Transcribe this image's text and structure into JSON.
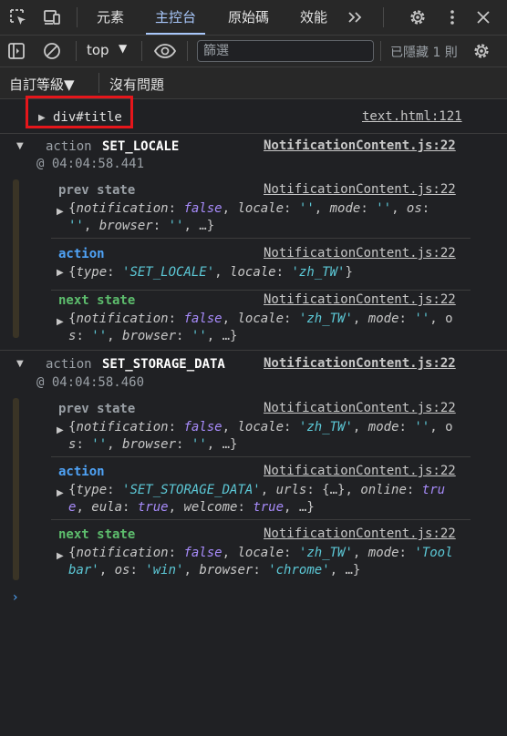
{
  "tabs": [
    {
      "label": "元素"
    },
    {
      "label": "主控台"
    },
    {
      "label": "原始碼"
    },
    {
      "label": "效能"
    }
  ],
  "toolbar": {
    "context": "top",
    "filter_placeholder": "篩選",
    "hidden_count": "已隱藏 1 則"
  },
  "levels": {
    "default_levels": "自訂等級▼",
    "issues": "沒有問題"
  },
  "console": {
    "element_log": {
      "text": "div#title",
      "source": "text.html:121"
    },
    "groups": [
      {
        "prefix": "action",
        "name": "SET_LOCALE",
        "time": "@ 04:04:58.441",
        "source": "NotificationContent.js:22",
        "entries": [
          {
            "label": "prev state",
            "source": "NotificationContent.js:22",
            "line1": [
              [
                "{",
                "p"
              ],
              [
                "notification",
                "i"
              ],
              [
                ": ",
                "p"
              ],
              [
                "false",
                "k"
              ],
              [
                ", ",
                "p"
              ],
              [
                "locale",
                "i"
              ],
              [
                ": ",
                "p"
              ],
              [
                "''",
                "s"
              ],
              [
                ", ",
                "p"
              ],
              [
                "mode",
                "i"
              ],
              [
                ": ",
                "p"
              ],
              [
                "''",
                "s"
              ],
              [
                ", ",
                "p"
              ],
              [
                "os",
                "i"
              ],
              [
                ":",
                "p"
              ]
            ],
            "line2": [
              [
                "''",
                "s"
              ],
              [
                ", ",
                "p"
              ],
              [
                "browser",
                "i"
              ],
              [
                ": ",
                "p"
              ],
              [
                "''",
                "s"
              ],
              [
                ", …}",
                "p"
              ]
            ]
          },
          {
            "label": "action",
            "source": "NotificationContent.js:22",
            "line1": [
              [
                "{",
                "p"
              ],
              [
                "type",
                "i"
              ],
              [
                ": ",
                "p"
              ],
              [
                "'SET_LOCALE'",
                "s"
              ],
              [
                ", ",
                "p"
              ],
              [
                "locale",
                "i"
              ],
              [
                ": ",
                "p"
              ],
              [
                "'zh_TW'",
                "s"
              ],
              [
                "}",
                "p"
              ]
            ],
            "line2": []
          },
          {
            "label": "next state",
            "source": "NotificationContent.js:22",
            "line1": [
              [
                "{",
                "p"
              ],
              [
                "notification",
                "i"
              ],
              [
                ": ",
                "p"
              ],
              [
                "false",
                "k"
              ],
              [
                ", ",
                "p"
              ],
              [
                "locale",
                "i"
              ],
              [
                ": ",
                "p"
              ],
              [
                "'zh_TW'",
                "s"
              ],
              [
                ", ",
                "p"
              ],
              [
                "mode",
                "i"
              ],
              [
                ": ",
                "p"
              ],
              [
                "''",
                "s"
              ],
              [
                ", o",
                "p"
              ]
            ],
            "line2": [
              [
                "s",
                "i"
              ],
              [
                ": ",
                "p"
              ],
              [
                "''",
                "s"
              ],
              [
                ", ",
                "p"
              ],
              [
                "browser",
                "i"
              ],
              [
                ": ",
                "p"
              ],
              [
                "''",
                "s"
              ],
              [
                ", …}",
                "p"
              ]
            ]
          }
        ]
      },
      {
        "prefix": "action",
        "name": "SET_STORAGE_DATA",
        "time": "@ 04:04:58.460",
        "source": "NotificationContent.js:22",
        "entries": [
          {
            "label": "prev state",
            "source": "NotificationContent.js:22",
            "line1": [
              [
                "{",
                "p"
              ],
              [
                "notification",
                "i"
              ],
              [
                ": ",
                "p"
              ],
              [
                "false",
                "k"
              ],
              [
                ", ",
                "p"
              ],
              [
                "locale",
                "i"
              ],
              [
                ": ",
                "p"
              ],
              [
                "'zh_TW'",
                "s"
              ],
              [
                ", ",
                "p"
              ],
              [
                "mode",
                "i"
              ],
              [
                ": ",
                "p"
              ],
              [
                "''",
                "s"
              ],
              [
                ", o",
                "p"
              ]
            ],
            "line2": [
              [
                "s",
                "i"
              ],
              [
                ": ",
                "p"
              ],
              [
                "''",
                "s"
              ],
              [
                ", ",
                "p"
              ],
              [
                "browser",
                "i"
              ],
              [
                ": ",
                "p"
              ],
              [
                "''",
                "s"
              ],
              [
                ", …}",
                "p"
              ]
            ]
          },
          {
            "label": "action",
            "source": "NotificationContent.js:22",
            "line1": [
              [
                "{",
                "p"
              ],
              [
                "type",
                "i"
              ],
              [
                ": ",
                "p"
              ],
              [
                "'SET_STORAGE_DATA'",
                "s"
              ],
              [
                ", ",
                "p"
              ],
              [
                "urls",
                "i"
              ],
              [
                ": {…}, ",
                "p"
              ],
              [
                "online",
                "i"
              ],
              [
                ": ",
                "p"
              ],
              [
                "tru",
                "k"
              ]
            ],
            "line2": [
              [
                "e",
                "k"
              ],
              [
                ", ",
                "p"
              ],
              [
                "eula",
                "i"
              ],
              [
                ": ",
                "p"
              ],
              [
                "true",
                "k"
              ],
              [
                ", ",
                "p"
              ],
              [
                "welcome",
                "i"
              ],
              [
                ": ",
                "p"
              ],
              [
                "true",
                "k"
              ],
              [
                ", …}",
                "p"
              ]
            ]
          },
          {
            "label": "next state",
            "source": "NotificationContent.js:22",
            "line1": [
              [
                "{",
                "p"
              ],
              [
                "notification",
                "i"
              ],
              [
                ": ",
                "p"
              ],
              [
                "false",
                "k"
              ],
              [
                ", ",
                "p"
              ],
              [
                "locale",
                "i"
              ],
              [
                ": ",
                "p"
              ],
              [
                "'zh_TW'",
                "s"
              ],
              [
                ", ",
                "p"
              ],
              [
                "mode",
                "i"
              ],
              [
                ": ",
                "p"
              ],
              [
                "'Tool",
                "s"
              ]
            ],
            "line2": [
              [
                "bar'",
                "s"
              ],
              [
                ", ",
                "p"
              ],
              [
                "os",
                "i"
              ],
              [
                ": ",
                "p"
              ],
              [
                "'win'",
                "s"
              ],
              [
                ", ",
                "p"
              ],
              [
                "browser",
                "i"
              ],
              [
                ": ",
                "p"
              ],
              [
                "'chrome'",
                "s"
              ],
              [
                ", …}",
                "p"
              ]
            ]
          }
        ]
      }
    ]
  },
  "colors": {
    "background": "#202124",
    "accent": "#a8c7fa",
    "highlight_box": "#e5161b",
    "action_label": "#4fa3f7",
    "next_label": "#5dbd6d",
    "string": "#5cc8d6",
    "keyword": "#a78bfa"
  }
}
